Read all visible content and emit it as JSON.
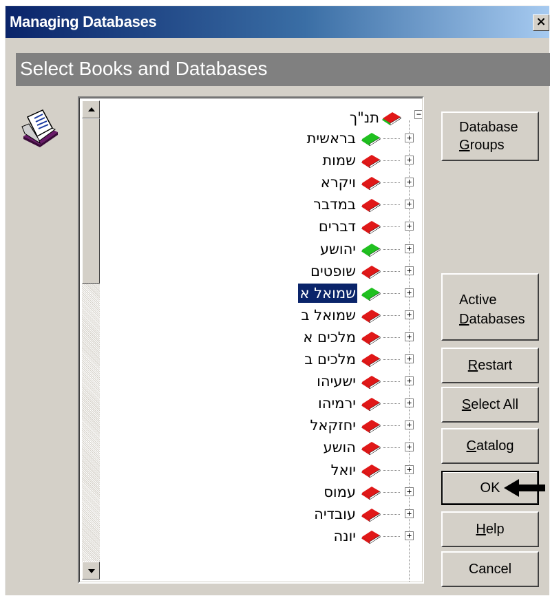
{
  "window": {
    "title": "Managing Databases",
    "close_glyph": "×"
  },
  "banner": {
    "text": "Select Books and Databases"
  },
  "icons": {
    "app": "book-with-page-icon",
    "book": "book-icon",
    "arrow": "arrow-left-icon"
  },
  "colors": {
    "title_start": "#0a246a",
    "title_end": "#a6caf0",
    "selection": "#0a246a",
    "book_red": "#e01818",
    "book_green": "#20c020"
  },
  "tree": {
    "root": {
      "label": "תנ\"ך",
      "expander": "−",
      "book_color": "mixed"
    },
    "items": [
      {
        "label": "בראשית",
        "book_color": "green",
        "expander": "+"
      },
      {
        "label": "שמות",
        "book_color": "red",
        "expander": "+"
      },
      {
        "label": "ויקרא",
        "book_color": "red",
        "expander": "+"
      },
      {
        "label": "במדבר",
        "book_color": "red",
        "expander": "+"
      },
      {
        "label": "דברים",
        "book_color": "red",
        "expander": "+"
      },
      {
        "label": "יהושע",
        "book_color": "green",
        "expander": "+"
      },
      {
        "label": "שופטים",
        "book_color": "red",
        "expander": "+"
      },
      {
        "label": "שמואל א",
        "book_color": "green",
        "expander": "+",
        "selected": true
      },
      {
        "label": "שמואל ב",
        "book_color": "red",
        "expander": "+"
      },
      {
        "label": "מלכים א",
        "book_color": "red",
        "expander": "+"
      },
      {
        "label": "מלכים ב",
        "book_color": "red",
        "expander": "+"
      },
      {
        "label": "ישעיהו",
        "book_color": "red",
        "expander": "+"
      },
      {
        "label": "ירמיהו",
        "book_color": "red",
        "expander": "+"
      },
      {
        "label": "יחזקאל",
        "book_color": "red",
        "expander": "+"
      },
      {
        "label": "הושע",
        "book_color": "red",
        "expander": "+"
      },
      {
        "label": "יואל",
        "book_color": "red",
        "expander": "+"
      },
      {
        "label": "עמוס",
        "book_color": "red",
        "expander": "+"
      },
      {
        "label": "עובדיה",
        "book_color": "red",
        "expander": "+"
      },
      {
        "label": "יונה",
        "book_color": "red",
        "expander": "+"
      }
    ]
  },
  "buttons": {
    "database_groups": {
      "line1": "Database",
      "line2_mnemonic": "G",
      "line2_rest": "roups"
    },
    "active_databases": {
      "line1": "Active",
      "line2_mnemonic": "D",
      "line2_rest": "atabases"
    },
    "restart": {
      "mnemonic": "R",
      "rest": "estart"
    },
    "select_all": {
      "mnemonic": "S",
      "rest": "elect All"
    },
    "catalog": {
      "mnemonic": "C",
      "rest": "atalog"
    },
    "ok": {
      "label": "OK"
    },
    "help": {
      "mnemonic": "H",
      "rest": "elp"
    },
    "cancel": {
      "label": "Cancel"
    }
  }
}
